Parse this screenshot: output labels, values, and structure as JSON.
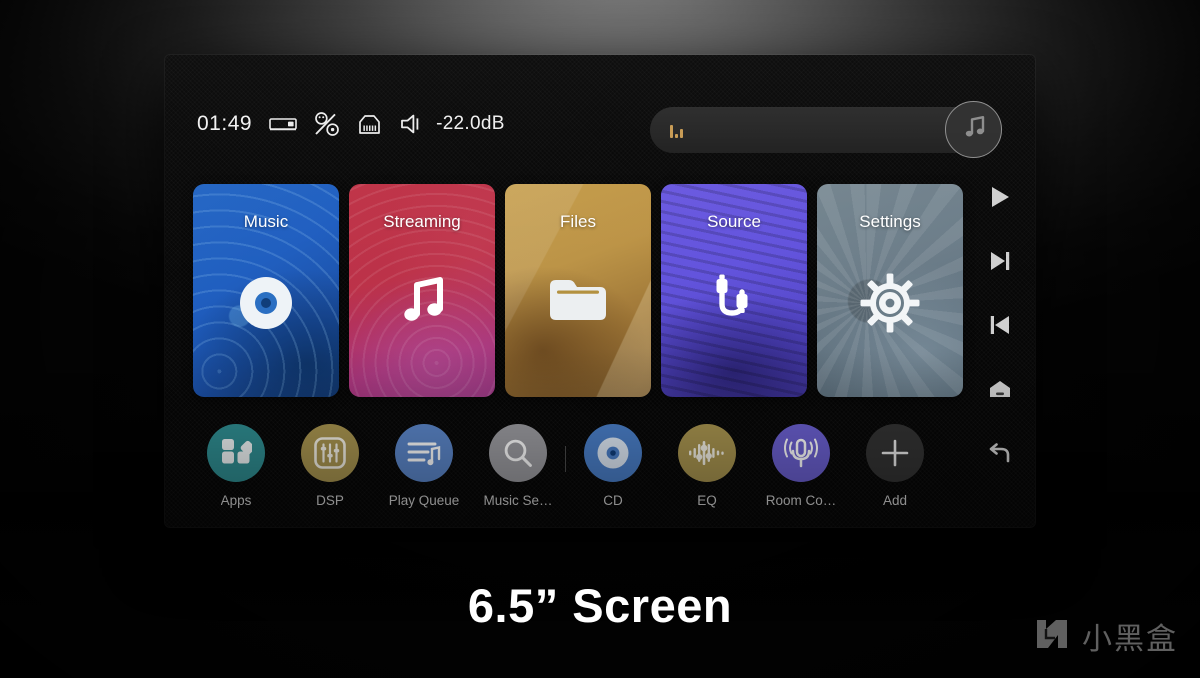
{
  "caption": "6.5” Screen",
  "statusbar": {
    "clock": "01:49",
    "volume": "-22.0dB",
    "icons": [
      {
        "name": "amplifier-device-icon"
      },
      {
        "name": "percent-power-icon"
      },
      {
        "name": "ethernet-port-icon"
      },
      {
        "name": "speaker-volume-icon"
      }
    ]
  },
  "searchbar": {
    "placeholder": "",
    "value": "",
    "level_meter_name": "audio-level-meter",
    "fab_icon": "music-note-icon"
  },
  "tiles": [
    {
      "label": "Music",
      "icon": "vinyl-record-icon",
      "color": "#2466c4",
      "art": "art-music"
    },
    {
      "label": "Streaming",
      "icon": "music-note-icon",
      "color": "#bf3347",
      "art": "art-stream"
    },
    {
      "label": "Files",
      "icon": "folder-icon",
      "color": "#c59d4a",
      "art": "art-files"
    },
    {
      "label": "Source",
      "icon": "cable-connector-icon",
      "color": "#6a59e0",
      "art": "art-source"
    },
    {
      "label": "Settings",
      "icon": "gear-icon",
      "color": "#74858f",
      "art": "art-settings"
    }
  ],
  "dock": [
    {
      "label": "Apps",
      "icon": "apps-grid-icon",
      "color": "#2f8d91"
    },
    {
      "label": "DSP",
      "icon": "sliders-icon",
      "color": "#a8944f"
    },
    {
      "label": "Play Queue",
      "icon": "playlist-queue-icon",
      "color": "#5b86c9"
    },
    {
      "label": "Music Se…",
      "icon": "search-icon",
      "color": "#9b9ba0"
    },
    {
      "label": "CD",
      "icon": "compact-disc-icon",
      "color": "#4a7fc9"
    },
    {
      "label": "EQ",
      "icon": "equalizer-icon",
      "color": "#a8944f"
    },
    {
      "label": "Room Co…",
      "icon": "microphone-icon",
      "color": "#6a5fcf"
    },
    {
      "label": "Add",
      "icon": "plus-icon",
      "color": "#333333"
    }
  ],
  "rail": [
    {
      "name": "play-icon"
    },
    {
      "name": "next-track-icon"
    },
    {
      "name": "previous-track-icon"
    },
    {
      "name": "home-icon"
    },
    {
      "name": "back-icon"
    }
  ],
  "watermark": {
    "text": "小黑盒",
    "logo_icon": "xiaoheihe-logo-icon"
  },
  "colors": {
    "accent_gold": "#c79a52",
    "screen_bg": "#060606",
    "text_primary": "#ffffff"
  }
}
